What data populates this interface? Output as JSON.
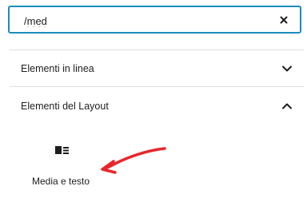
{
  "search": {
    "value": "/med",
    "clear_icon": "close-icon"
  },
  "panels": [
    {
      "title": "Elementi in linea",
      "state": "collapsed",
      "icon": "chevron-down-icon"
    },
    {
      "title": "Elementi del Layout",
      "state": "expanded",
      "icon": "chevron-up-icon"
    }
  ],
  "blocks": [
    {
      "label": "Media e testo",
      "icon": "media-text-icon"
    }
  ],
  "colors": {
    "accent": "#1e8cbe",
    "annotation": "#e8262b",
    "spellcheck": "#d63638",
    "divider": "#e0e0e0"
  }
}
